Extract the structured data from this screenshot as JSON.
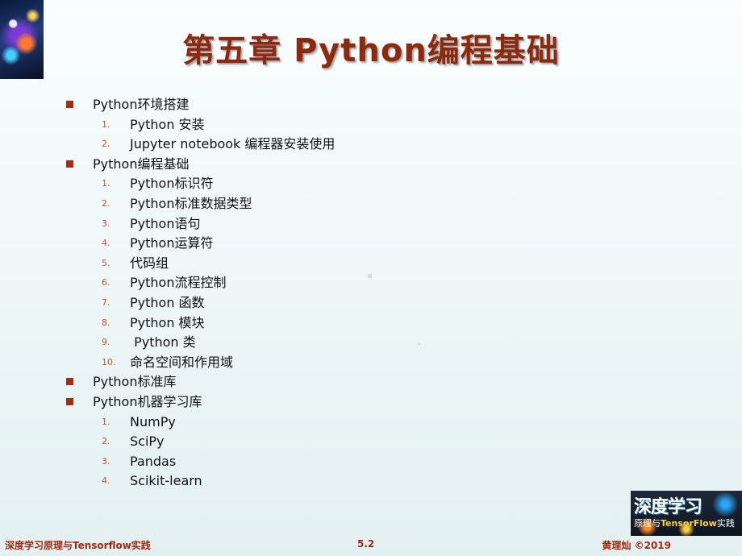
{
  "slide": {
    "title": "第五章  Python编程基础",
    "outline": [
      {
        "text": "Python环境搭建",
        "items": [
          {
            "num": "1.",
            "text": "Python 安装"
          },
          {
            "num": "2.",
            "text": "Jupyter notebook 编程器安装使用"
          }
        ]
      },
      {
        "text": "Python编程基础",
        "items": [
          {
            "num": "1.",
            "text": "Python标识符"
          },
          {
            "num": "2.",
            "text": "Python标准数据类型"
          },
          {
            "num": "3.",
            "text": "Python语句"
          },
          {
            "num": "4.",
            "text": "Python运算符"
          },
          {
            "num": "5.",
            "text": "代码组"
          },
          {
            "num": "6.",
            "text": "Python流程控制"
          },
          {
            "num": "7.",
            "text": "Python 函数"
          },
          {
            "num": "8.",
            "text": "Python 模块"
          },
          {
            "num": "9.",
            "text": " Python 类"
          },
          {
            "num": "10.",
            "text": "命名空间和作用域"
          }
        ]
      },
      {
        "text": "Python标准库",
        "items": []
      },
      {
        "text": "Python机器学习库",
        "items": [
          {
            "num": "1.",
            "text": "NumPy"
          },
          {
            "num": "2.",
            "text": "SciPy"
          },
          {
            "num": "3.",
            "text": "Pandas"
          },
          {
            "num": "4.",
            "text": "Scikit-learn"
          }
        ]
      }
    ],
    "book_cover": {
      "title": "深度学习",
      "subtitle_prefix": "原理与",
      "subtitle_highlight": "TensorFlow",
      "subtitle_suffix": "实践"
    },
    "footer": {
      "left": "深度学习原理与Tensorflow实践",
      "center": "5.2",
      "right": "黄理灿 ©2019"
    },
    "colors": {
      "title": "#8c2a10",
      "bullet": "#a42b14",
      "number": "#c0552c",
      "footer": "#a02a10"
    }
  }
}
